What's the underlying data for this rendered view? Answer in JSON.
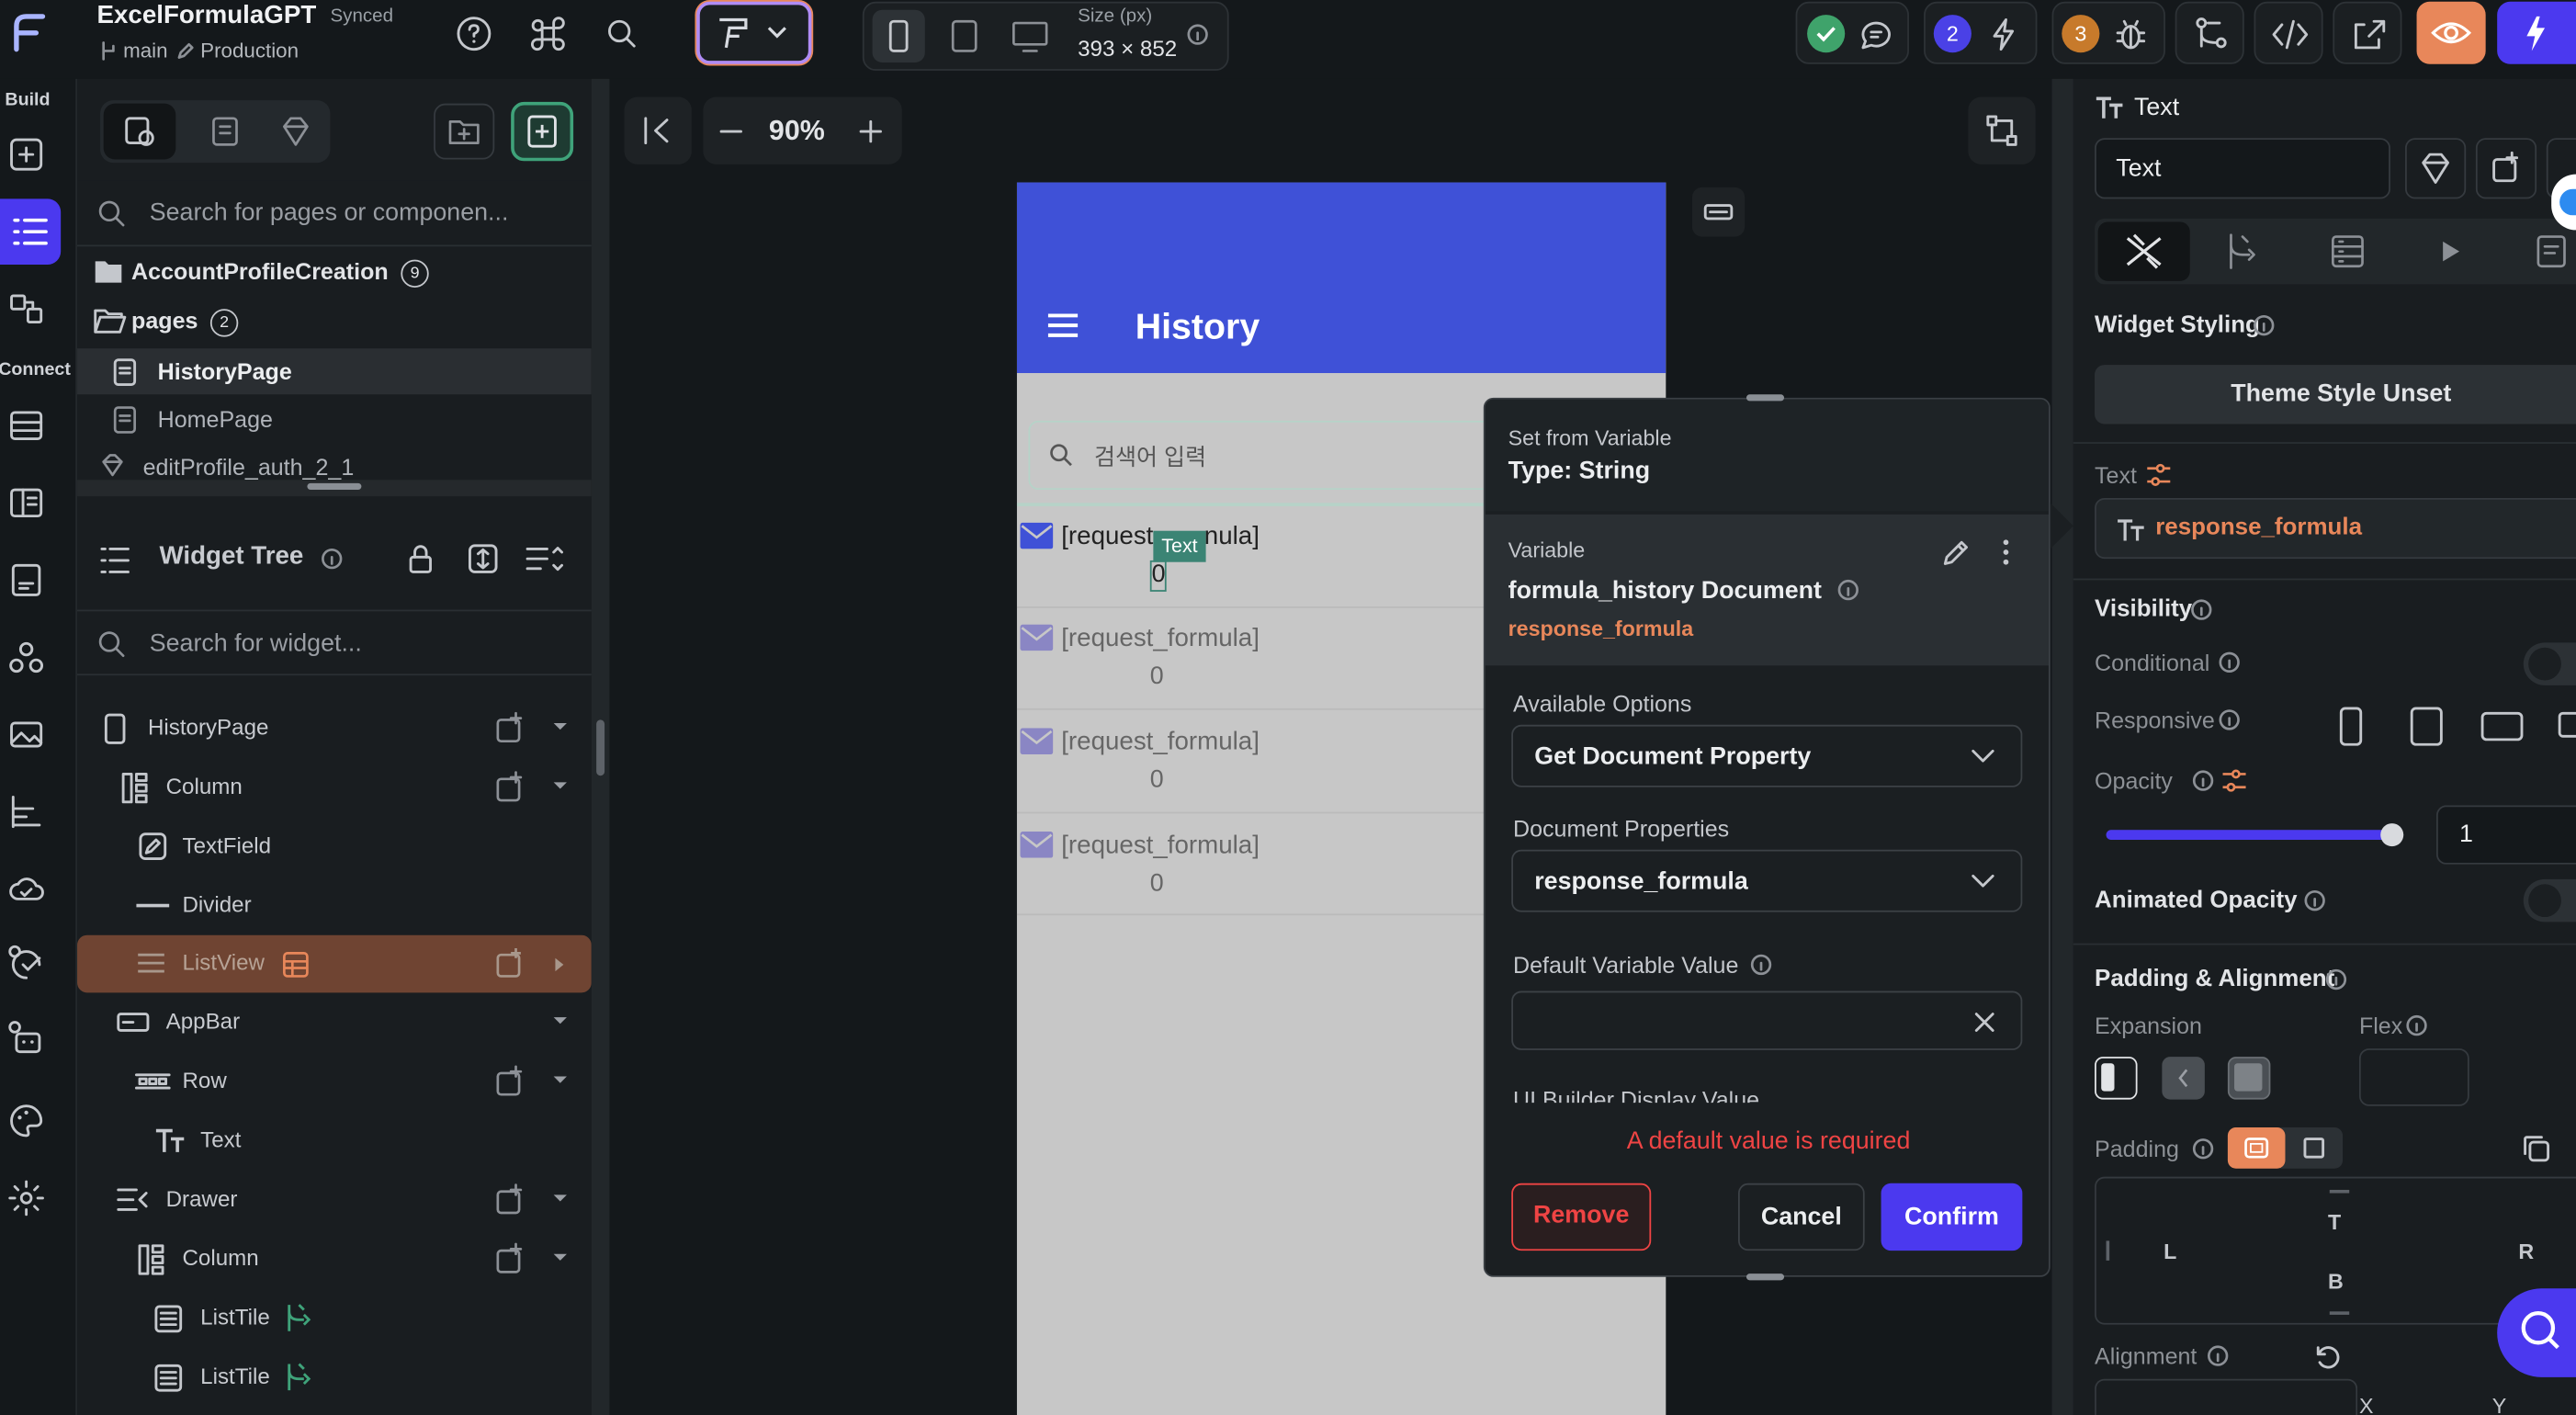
{
  "topbar": {
    "project_name": "ExcelFormulaGPT",
    "sync_status": "Synced",
    "branch": "main",
    "environment": "Production",
    "size_label": "Size (px)",
    "size_value": "393 × 852",
    "badge_issues": "2",
    "badge_bugs": "3"
  },
  "rail": {
    "build_label": "Build",
    "connect_label": "Connect"
  },
  "left_panel": {
    "search_pages_placeholder": "Search for pages or componen...",
    "folders": [
      {
        "label": "AccountProfileCreation",
        "count": "9"
      },
      {
        "label": "pages",
        "count": "2"
      }
    ],
    "pages": [
      "HistoryPage",
      "HomePage",
      "editProfile_auth_2_1"
    ],
    "widget_tree_title": "Widget Tree",
    "search_widget_placeholder": "Search for widget...",
    "tree": [
      "HistoryPage",
      "Column",
      "TextField",
      "Divider",
      "ListView",
      "AppBar",
      "Row",
      "Text",
      "Drawer",
      "Column",
      "ListTile",
      "ListTile"
    ]
  },
  "canvas": {
    "zoom": "90%",
    "app_title": "History",
    "search_placeholder": "검색어 입력",
    "list_items": [
      {
        "title": "[request_formula]",
        "subtitle": "0"
      },
      {
        "title": "[request_formula]",
        "subtitle": "0"
      },
      {
        "title": "[request_formula]",
        "subtitle": "0"
      },
      {
        "title": "[request_formula]",
        "subtitle": "0"
      }
    ],
    "selected_tag": "Text",
    "first_title_left": "[request",
    "first_title_right": "nula]"
  },
  "popup": {
    "header_label": "Set from Variable",
    "type_label": "Type: String",
    "variable_label": "Variable",
    "variable_name": "formula_history Document",
    "variable_field": "response_formula",
    "available_options_label": "Available Options",
    "available_options_value": "Get Document Property",
    "document_properties_label": "Document Properties",
    "document_properties_value": "response_formula",
    "default_value_label": "Default Variable Value",
    "default_value_input": "",
    "ui_builder_label": "UI Builder Display Value",
    "error_text": "A default value is required",
    "remove_label": "Remove",
    "cancel_label": "Cancel",
    "confirm_label": "Confirm"
  },
  "right_panel": {
    "title": "Text",
    "name_field": "Text",
    "widget_styling_label": "Widget Styling",
    "theme_style": "Theme Style Unset",
    "text_label": "Text",
    "text_value": "response_formula",
    "visibility_label": "Visibility",
    "conditional_label": "Conditional",
    "responsive_label": "Responsive",
    "opacity_label": "Opacity",
    "opacity_value": "1",
    "opacity_fraction": 1,
    "animated_opacity_label": "Animated Opacity",
    "padding_alignment_label": "Padding & Alignment",
    "expansion_label": "Expansion",
    "flex_label": "Flex",
    "padding_label": "Padding",
    "pad_t": "T",
    "pad_l": "L",
    "pad_r": "R",
    "pad_b": "B",
    "alignment_label": "Alignment",
    "align_x": "X",
    "align_y": "Y"
  },
  "colors": {
    "accent": "#4b39ef",
    "appbar": "#3f51d7",
    "error": "#ef4444",
    "orange": "#e8875a"
  }
}
